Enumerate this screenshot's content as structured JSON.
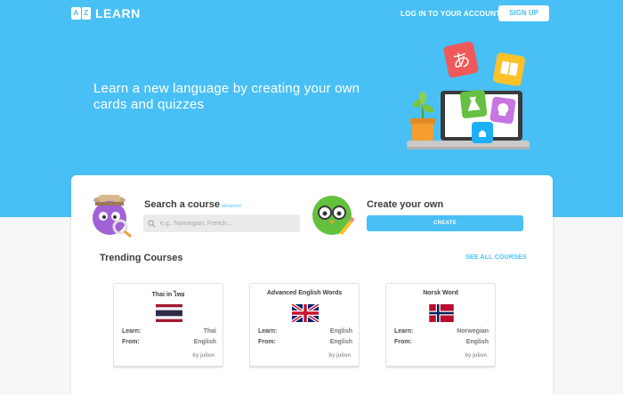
{
  "brand": {
    "logo_letters": [
      "A",
      "Z"
    ],
    "name": "LEARN"
  },
  "nav": {
    "login": "LOG IN TO YOUR ACCOUNT",
    "signup": "SIGN UP"
  },
  "hero": {
    "headline": "Learn a new language by creating your own cards and quizzes",
    "card_glyph": "あ"
  },
  "search": {
    "title": "Search a course",
    "advanced": "advanced",
    "placeholder": "e.g., Norwegian, French..."
  },
  "create": {
    "title": "Create your own",
    "button": "CREATE"
  },
  "trending": {
    "title": "Trending Courses",
    "see_all": "SEE ALL COURSES",
    "courses": [
      {
        "title": "Thai in ไทย",
        "flag": "thailand-flag",
        "learn_label": "Learn:",
        "learn": "Thai",
        "from_label": "From:",
        "from": "English",
        "author": "by julion"
      },
      {
        "title": "Advanced English Words",
        "flag": "uk-flag",
        "learn_label": "Learn:",
        "learn": "English",
        "from_label": "From:",
        "from": "English",
        "author": "by julion"
      },
      {
        "title": "Norsk Word",
        "flag": "norway-flag",
        "learn_label": "Learn:",
        "learn": "Norwegian",
        "from_label": "From:",
        "from": "English",
        "author": "by julion"
      }
    ]
  },
  "colors": {
    "brand_blue": "#49c0f5",
    "background": "#f7f7f7"
  }
}
